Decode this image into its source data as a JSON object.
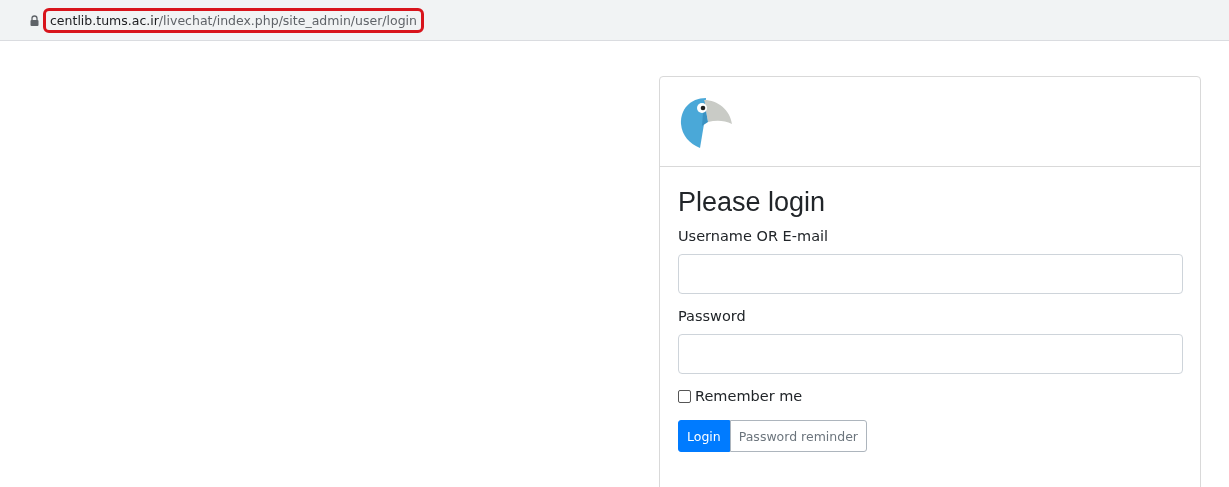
{
  "address_bar": {
    "host": "centlib.tums.ac.ir",
    "path": "/livechat/index.php/site_admin/user/login",
    "highlighted": true
  },
  "login": {
    "title": "Please login",
    "fields": [
      {
        "label": "Username OR E-mail"
      },
      {
        "label": "Password"
      }
    ],
    "remember": {
      "label": "Remember me",
      "checked": false
    },
    "buttons": [
      {
        "label": "Login",
        "primary": true
      },
      {
        "label": "Password reminder",
        "primary": false
      }
    ]
  }
}
